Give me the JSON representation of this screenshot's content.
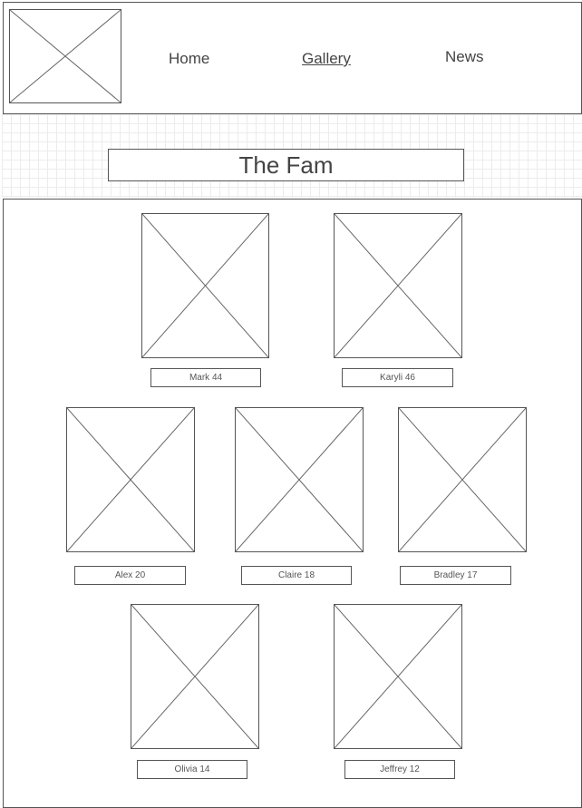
{
  "header": {
    "logo_icon": "image-placeholder-icon",
    "nav": [
      {
        "label": "Home",
        "active": false
      },
      {
        "label": "Gallery",
        "active": true
      },
      {
        "label": "News",
        "active": false
      }
    ]
  },
  "title": "The Fam",
  "gallery": {
    "members": [
      {
        "caption": "Mark 44"
      },
      {
        "caption": "Karyli 46"
      },
      {
        "caption": "Alex 20"
      },
      {
        "caption": "Claire 18"
      },
      {
        "caption": "Bradley 17"
      },
      {
        "caption": "Olivia 14"
      },
      {
        "caption": "Jeffrey 12"
      }
    ]
  },
  "colors": {
    "border": "#555555",
    "text": "#444444",
    "grid": "#ececec",
    "background": "#ffffff"
  }
}
